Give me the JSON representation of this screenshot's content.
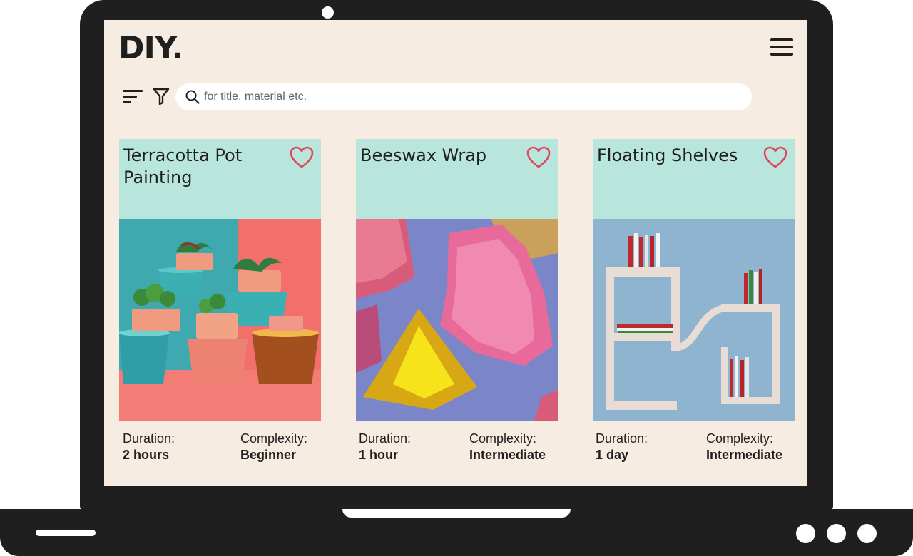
{
  "header": {
    "logo": "DIY."
  },
  "search": {
    "placeholder": "for title, material etc."
  },
  "cards": [
    {
      "title": "Terracotta Pot Painting",
      "duration_label": "Duration:",
      "duration": "2 hours",
      "complexity_label": "Complexity:",
      "complexity": "Beginner"
    },
    {
      "title": "Beeswax Wrap",
      "duration_label": "Duration:",
      "duration": "1 hour",
      "complexity_label": "Complexity:",
      "complexity": "Intermediate"
    },
    {
      "title": "Floating Shelves",
      "duration_label": "Duration:",
      "duration": "1 day",
      "complexity_label": "Complexity:",
      "complexity": "Intermediate"
    }
  ],
  "colors": {
    "background": "#f7ece2",
    "card_header": "#b9e6dc",
    "heart": "#e0475c",
    "frame": "#1f1f1f"
  },
  "icons": [
    "hamburger-menu-icon",
    "sort-icon",
    "filter-icon",
    "search-icon",
    "heart-icon"
  ]
}
